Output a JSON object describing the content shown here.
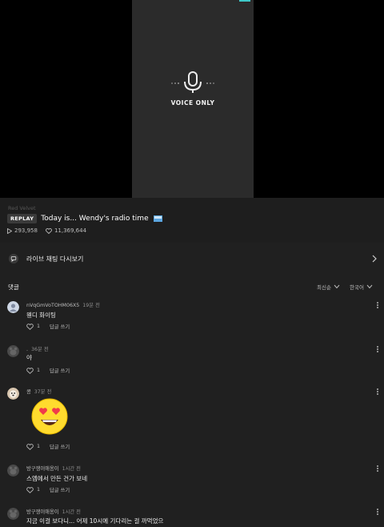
{
  "video": {
    "voice_label": "VOICE ONLY"
  },
  "info": {
    "artist": "Red Velvet",
    "replay_badge": "REPLAY",
    "title": "Today is... Wendy's radio time",
    "plays": "293,958",
    "likes": "11,369,644"
  },
  "chat_replay": {
    "label": "라이브 채팅 다시보기"
  },
  "comments_header": {
    "title": "댓글",
    "sort": "최신순",
    "language": "한국어"
  },
  "comments": [
    {
      "user": "nVqGmVoTOHM06X5",
      "time": "19분 전",
      "text": "웬디 화이팅",
      "likes": "1",
      "reply": "답글 쓰기"
    },
    {
      "user": ".",
      "time": "36분 전",
      "text": "야",
      "likes": "1",
      "reply": "답글 쓰기"
    },
    {
      "user": "콩",
      "time": "37분 전",
      "text": "",
      "likes": "1",
      "reply": "답글 쓰기",
      "emoji": "heart-eyes-emoji"
    },
    {
      "user": "방구쟁이애옹이",
      "time": "1시간 전",
      "text": "스엠에서 만든 건가 보네",
      "likes": "1",
      "reply": "답글 쓰기"
    },
    {
      "user": "방구쟁이애옹이",
      "time": "1시간 전",
      "text": "지금 이걸 보다니... 어제 10시에 기다리는 걸 까먹었으",
      "likes": "",
      "reply": ""
    }
  ]
}
